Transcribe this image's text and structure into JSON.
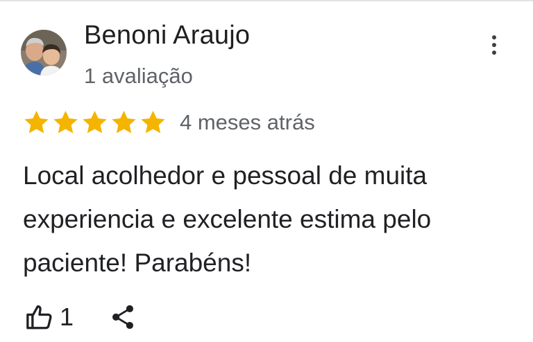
{
  "review": {
    "reviewer_name": "Benoni Araujo",
    "review_count": "1 avaliação",
    "rating": 5,
    "rating_max": 5,
    "date": "4 meses atrás",
    "text": "Local acolhedor e pessoal de muita experiencia e excelente estima pelo paciente! Parabéns!",
    "like_count": "1"
  },
  "icons": {
    "avatar": "avatar-photo",
    "more": "more-vert-icon",
    "star": "star-icon",
    "like": "thumb-up-icon",
    "share": "share-icon"
  },
  "colors": {
    "star": "#F4B400",
    "name_text": "#1f1f1f",
    "secondary_text": "#5f6368",
    "body_text": "#202124"
  }
}
